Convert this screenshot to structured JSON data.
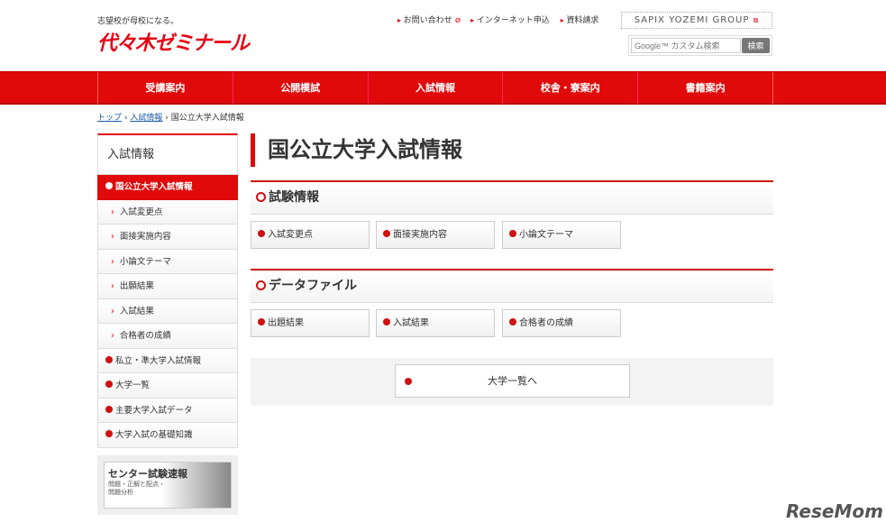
{
  "header": {
    "tagline": "志望校が母校になる。",
    "logo": "代々木ゼミナール",
    "links": [
      "お問い合わせ",
      "インターネット申込",
      "資料請求"
    ],
    "group": "SAPIX YOZEMI GROUP",
    "search_placeholder": "Google™ カスタム検索",
    "search_button": "検索"
  },
  "nav": [
    "受講案内",
    "公開模試",
    "入試情報",
    "校舎・寮案内",
    "書籍案内"
  ],
  "breadcrumb": {
    "top": "トップ",
    "section": "入試情報",
    "current": "国公立大学入試情報"
  },
  "sidebar": {
    "heading": "入試情報",
    "active": "国公立大学入試情報",
    "subitems": [
      "入試変更点",
      "面接実施内容",
      "小論文テーマ",
      "出願結果",
      "入試結果",
      "合格者の成績"
    ],
    "items": [
      "私立・準大学入試情報",
      "大学一覧",
      "主要大学入試データ",
      "大学入試の基礎知識"
    ],
    "banner_title": "センター試験速報",
    "banner_sub1": "問題・正解と配点・",
    "banner_sub2": "問題分析"
  },
  "main": {
    "title": "国公立大学入試情報",
    "sections": [
      {
        "title": "試験情報",
        "buttons": [
          "入試変更点",
          "面接実施内容",
          "小論文テーマ"
        ]
      },
      {
        "title": "データファイル",
        "buttons": [
          "出題結果",
          "入試結果",
          "合格者の成績"
        ]
      }
    ],
    "list_button": "大学一覧へ"
  },
  "watermark": "ReseMom"
}
